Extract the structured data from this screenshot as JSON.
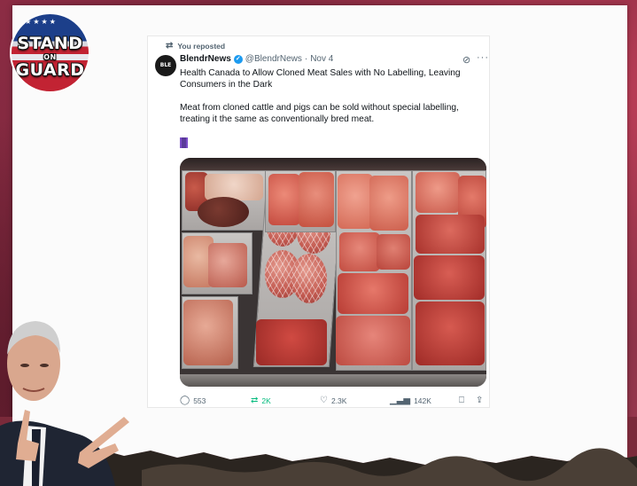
{
  "logo": {
    "line1": "STAND",
    "line2": "ON",
    "line3": "GUARD"
  },
  "tweet": {
    "repost_label": "You reposted",
    "author_name": "BlendrNews",
    "author_handle": "@BlendrNews",
    "separator": "·",
    "date": "Nov 4",
    "avatar_text": "BLE NEWS",
    "paragraph1": "Health Canada to Allow Cloned Meat Sales with No Labelling, Leaving Consumers in the Dark",
    "paragraph2": "Meat from cloned cattle and pigs can be sold without special labelling, treating it the same as conventionally bred meat.",
    "actions": {
      "replies": "553",
      "reposts": "2K",
      "likes": "2.3K",
      "views": "142K"
    }
  },
  "colors": {
    "accent": "#1d9bf0",
    "repost_active": "#00ba7c",
    "muted": "#536471",
    "frame": "#8c2c44"
  },
  "icons": [
    "repost-icon",
    "verified-badge-icon",
    "grok-icon",
    "more-icon",
    "canada-flag-icon",
    "reply-icon",
    "like-icon",
    "views-icon",
    "bookmark-icon",
    "share-icon"
  ]
}
